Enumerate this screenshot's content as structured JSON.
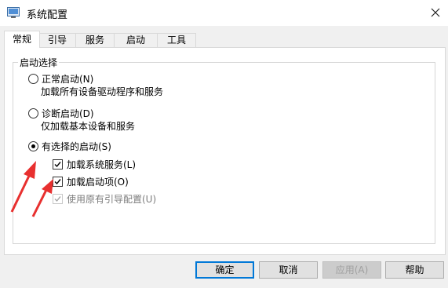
{
  "window": {
    "title": "系统配置"
  },
  "tabs": [
    {
      "label": "常规",
      "active": true
    },
    {
      "label": "引导",
      "active": false
    },
    {
      "label": "服务",
      "active": false
    },
    {
      "label": "启动",
      "active": false
    },
    {
      "label": "工具",
      "active": false
    }
  ],
  "startup_selection": {
    "legend": "启动选择",
    "options": [
      {
        "label": "正常启动(N)",
        "description": "加载所有设备驱动程序和服务",
        "checked": false
      },
      {
        "label": "诊断启动(D)",
        "description": "仅加载基本设备和服务",
        "checked": false
      },
      {
        "label": "有选择的启动(S)",
        "checked": true
      }
    ],
    "selective": [
      {
        "label": "加载系统服务(L)",
        "checked": true,
        "enabled": true
      },
      {
        "label": "加载启动项(O)",
        "checked": true,
        "enabled": true
      },
      {
        "label": "使用原有引导配置(U)",
        "checked": true,
        "enabled": false
      }
    ]
  },
  "buttons": {
    "ok": "确定",
    "cancel": "取消",
    "apply": "应用(A)",
    "help": "帮助"
  },
  "colors": {
    "annotation_arrow": "#e8302f",
    "focus": "#0078d7"
  },
  "icons": {
    "app": "msconfig-icon",
    "close": "close-icon"
  }
}
